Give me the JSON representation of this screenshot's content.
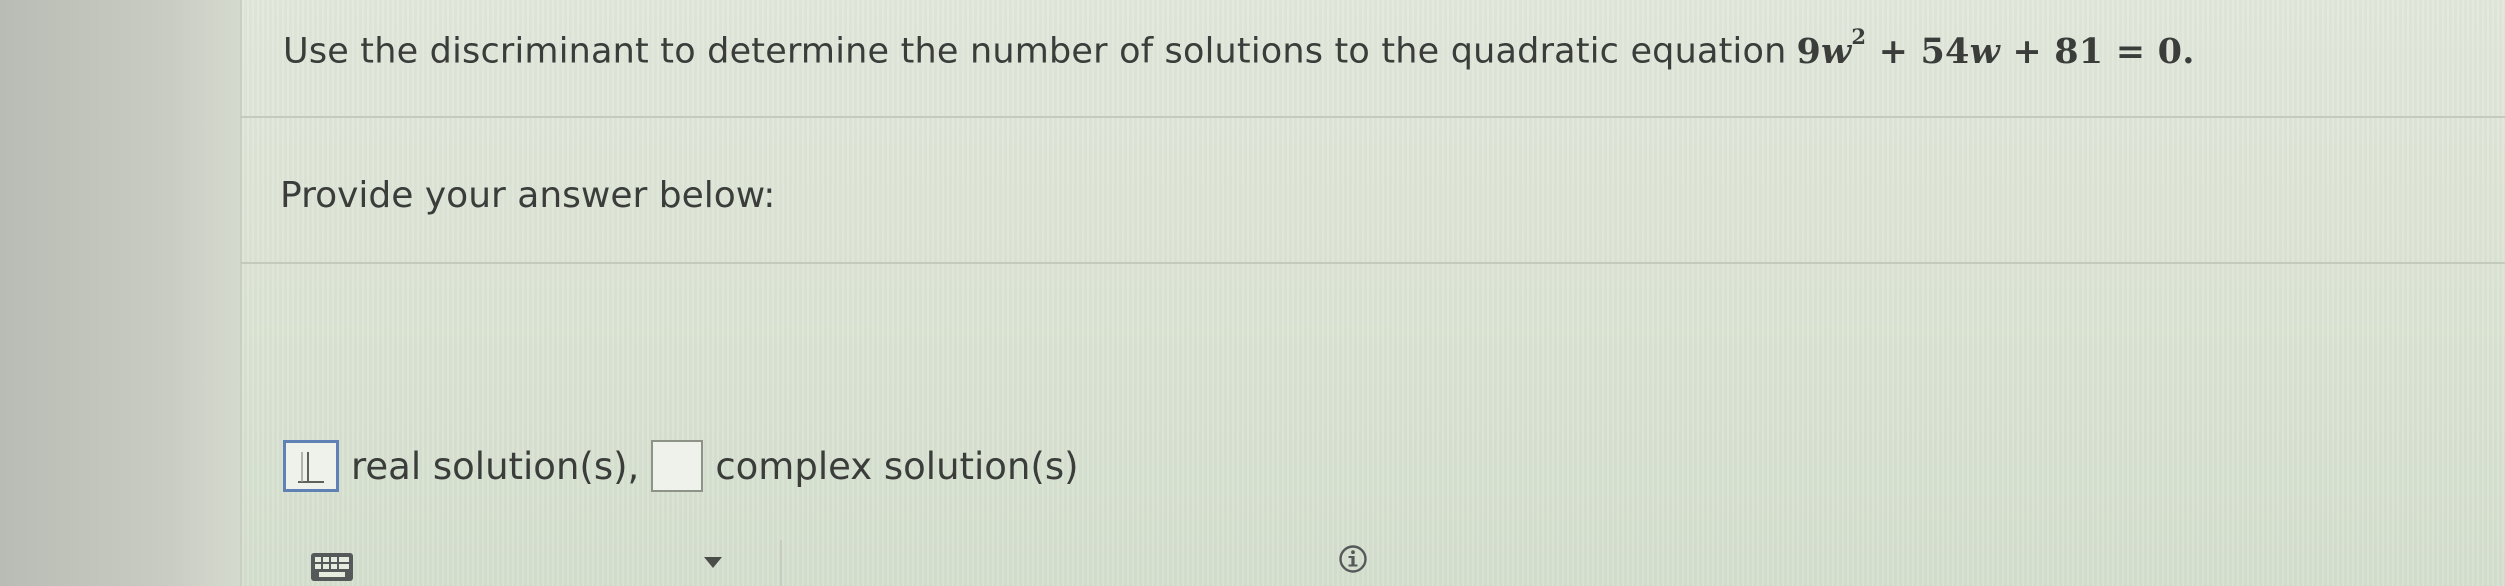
{
  "question": {
    "text": "Use the discriminant to determine the number of solutions to the quadratic equation",
    "equation": {
      "coef_a": "9",
      "var": "w",
      "exponent": "2",
      "rest": "+ 54",
      "var2": "w",
      "tail": "+ 81 = 0."
    }
  },
  "prompt": {
    "text": "Provide your answer below:"
  },
  "answer": {
    "real_value": "",
    "real_label": "real solution(s),",
    "complex_value": "",
    "complex_label": "complex solution(s)"
  },
  "toolbar": {
    "keyboard_icon": "keyboard-icon",
    "dropdown_icon": "caret-down-icon",
    "info_icon": "info-icon"
  },
  "colors": {
    "focus_border": "#5f81b5",
    "text": "#3a3d3a",
    "background": "#dde5d6"
  }
}
